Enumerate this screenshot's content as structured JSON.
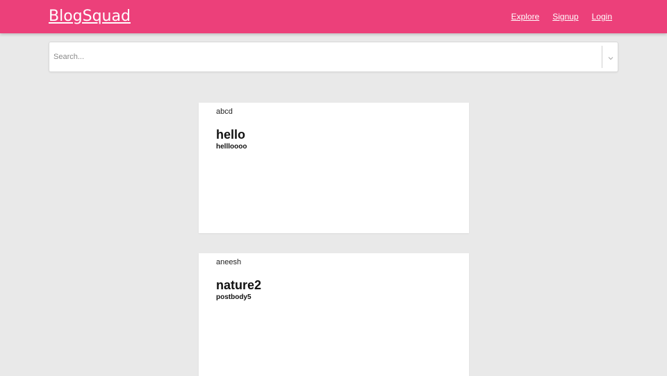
{
  "navbar": {
    "brand": "BlogSquad",
    "links": [
      "Explore",
      "Signup",
      "Login"
    ],
    "color": "#ec407a"
  },
  "search": {
    "placeholder": "Search...",
    "value": "",
    "dropdown_icon": "chevron-down-icon"
  },
  "posts": [
    {
      "author": "abcd",
      "title": "hello",
      "body": "hellloooo"
    },
    {
      "author": "aneesh",
      "title": "nature2",
      "body": "postbody5"
    }
  ]
}
